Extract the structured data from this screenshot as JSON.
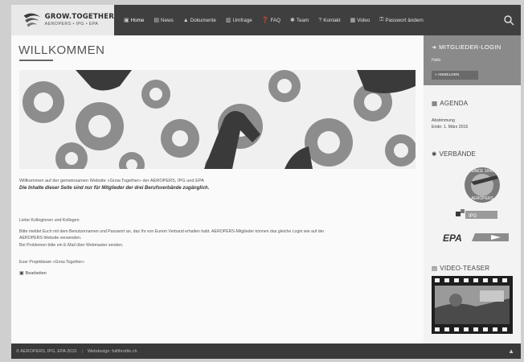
{
  "logo": {
    "title": "GROW.TOGETHER",
    "subtitle": "AEROPERS • IPG • EPA"
  },
  "nav": [
    {
      "icon": "home-icon",
      "glyph": "▣",
      "label": "Home"
    },
    {
      "icon": "news-icon",
      "glyph": "▤",
      "label": "News"
    },
    {
      "icon": "documents-icon",
      "glyph": "▲",
      "label": "Dokumente"
    },
    {
      "icon": "survey-icon",
      "glyph": "▥",
      "label": "Umfrage"
    },
    {
      "icon": "faq-icon",
      "glyph": "❓",
      "label": "FAQ"
    },
    {
      "icon": "team-icon",
      "glyph": "✱",
      "label": "Team"
    },
    {
      "icon": "contact-icon",
      "glyph": "?",
      "label": "Kontakt"
    },
    {
      "icon": "video-icon",
      "glyph": "▦",
      "label": "Video"
    },
    {
      "icon": "password-icon",
      "glyph": "⚿",
      "label": "Passwort ändern"
    }
  ],
  "main": {
    "title": "WILLKOMMEN",
    "intro_line1": "Willkommen auf der gemeinsamen Website «Grow.Together» der AEROPERS, IPG und EPA",
    "intro_line2": "Die Inhalte dieser Seite sind nur für Mitglieder der drei Berufsverbände zugänglich.",
    "greeting": "Liebe Kolleginnen und Kollegen",
    "body_line1": "Bitte meldet Euch mit dem Benutzernamen und Passwort an, das Ihr von Eurem Verband erhalten habt. AEROPERS-Mitglieder können das gleiche Login wie auf der",
    "body_line2": "AEROPERS-Website verwenden.",
    "body_line3": "Bei Problemen bitte ein E-Mail über Webmaster senden.",
    "signoff": "Euer Projektteam «Grow.Together»",
    "edit_label": "Bearbeiten"
  },
  "sidebar": {
    "login_title": "MITGLIEDER-LOGIN",
    "login_sub": "Hallo",
    "login_button": "» ANMELDEN",
    "agenda_title": "AGENDA",
    "agenda_item": "Abstimmung",
    "agenda_date": "Ende: 1. März 2016",
    "associations_title": "VERBÄNDE",
    "emblem_text": "SINCE 1945 AEROPERS",
    "ipg_text": "IPG",
    "epa_text": "EPA",
    "video_title": "VIDEO-TEASER"
  },
  "footer": {
    "copyright": "© AEROPERS, IPG, EPA 2015",
    "credit": "Webdesign: fullthrottle.ch"
  },
  "colors": {
    "header_bg": "#3f3f3f",
    "footer_bg": "#3a3a3a",
    "login_box": "#8a8a8a"
  }
}
